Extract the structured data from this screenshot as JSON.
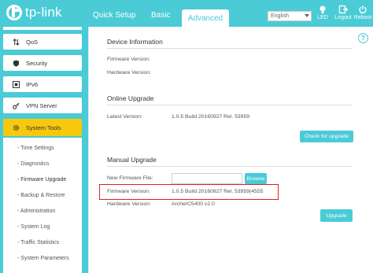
{
  "header": {
    "brand": "tp-link",
    "tabs": [
      {
        "label": "Quick Setup"
      },
      {
        "label": "Basic"
      },
      {
        "label": "Advanced"
      }
    ],
    "language": "English",
    "actions": [
      {
        "label": "LED",
        "icon": "bulb-icon"
      },
      {
        "label": "Logout",
        "icon": "logout-icon"
      },
      {
        "label": "Reboot",
        "icon": "power-icon"
      }
    ]
  },
  "sidebar": {
    "items": [
      {
        "label": "QoS",
        "icon": "qos-arrows-icon"
      },
      {
        "label": "Security",
        "icon": "shield-icon"
      },
      {
        "label": "IPv6",
        "icon": "ipv6-icon"
      },
      {
        "label": "VPN Server",
        "icon": "key-icon"
      },
      {
        "label": "System Tools",
        "icon": "gear-icon",
        "active": true
      }
    ],
    "subitems": [
      "- Time Settings",
      "- Diagnostics",
      "- Firmware Upgrade",
      "- Backup & Restore",
      "- Administration",
      "- System Log",
      "- Traffic Statistics",
      "- System Parameters"
    ]
  },
  "main": {
    "device_info": {
      "title": "Device Information",
      "firmware_label": "Firmware Version:",
      "hardware_label": "Hardware Version:"
    },
    "online_upgrade": {
      "title": "Online Upgrade",
      "latest_label": "Latest Version:",
      "latest_value": "1.0.5 Build 20160927 Rel. 53959",
      "check_button": "Check for upgrade"
    },
    "manual_upgrade": {
      "title": "Manual Upgrade",
      "new_file_label": "New Firmware File:",
      "browse_button": "Browse",
      "firmware_label": "Firmware Version:",
      "firmware_value": "1.0.5 Build 20160927 Rel. 53959(4555",
      "hardware_label": "Hardware Version:",
      "hardware_value": "ArcherC5400 v2.0",
      "upgrade_button": "Upgrade"
    }
  },
  "colors": {
    "brand": "#4acbd6",
    "active_menu": "#f7c90e",
    "highlight": "#e02020"
  }
}
